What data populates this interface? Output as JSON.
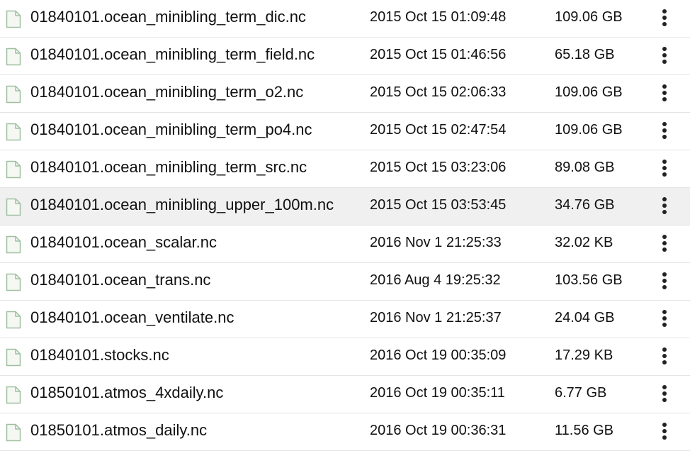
{
  "files": [
    {
      "name": "01840101.ocean_minibling_term_dic.nc",
      "date": "2015 Oct 15 01:09:48",
      "size": "109.06 GB",
      "icon": "file-icon",
      "highlighted": false
    },
    {
      "name": "01840101.ocean_minibling_term_field.nc",
      "date": "2015 Oct 15 01:46:56",
      "size": "65.18 GB",
      "icon": "file-icon",
      "highlighted": false
    },
    {
      "name": "01840101.ocean_minibling_term_o2.nc",
      "date": "2015 Oct 15 02:06:33",
      "size": "109.06 GB",
      "icon": "file-icon",
      "highlighted": false
    },
    {
      "name": "01840101.ocean_minibling_term_po4.nc",
      "date": "2015 Oct 15 02:47:54",
      "size": "109.06 GB",
      "icon": "file-icon",
      "highlighted": false
    },
    {
      "name": "01840101.ocean_minibling_term_src.nc",
      "date": "2015 Oct 15 03:23:06",
      "size": "89.08 GB",
      "icon": "file-icon",
      "highlighted": false
    },
    {
      "name": "01840101.ocean_minibling_upper_100m.nc",
      "date": "2015 Oct 15 03:53:45",
      "size": "34.76 GB",
      "icon": "file-icon",
      "highlighted": true
    },
    {
      "name": "01840101.ocean_scalar.nc",
      "date": "2016 Nov 1 21:25:33",
      "size": "32.02 KB",
      "icon": "file-icon",
      "highlighted": false
    },
    {
      "name": "01840101.ocean_trans.nc",
      "date": "2016 Aug 4 19:25:32",
      "size": "103.56 GB",
      "icon": "file-icon",
      "highlighted": false
    },
    {
      "name": "01840101.ocean_ventilate.nc",
      "date": "2016 Nov 1 21:25:37",
      "size": "24.04 GB",
      "icon": "file-icon",
      "highlighted": false
    },
    {
      "name": "01840101.stocks.nc",
      "date": "2016 Oct 19 00:35:09",
      "size": "17.29 KB",
      "icon": "file-icon",
      "highlighted": false
    },
    {
      "name": "01850101.atmos_4xdaily.nc",
      "date": "2016 Oct 19 00:35:11",
      "size": "6.77 GB",
      "icon": "file-icon",
      "highlighted": false
    },
    {
      "name": "01850101.atmos_daily.nc",
      "date": "2016 Oct 19 00:36:31",
      "size": "11.56 GB",
      "icon": "file-icon",
      "highlighted": false
    }
  ],
  "colors": {
    "highlight_row": "#f0f0f0",
    "row_divider": "#e4e4e4",
    "icon_stroke": "#9fbfa0",
    "icon_fill": "#f4f7f2",
    "text": "#111111",
    "menu_dots": "#222222"
  },
  "icons": {
    "file": "file-icon",
    "menu": "more-vert-icon"
  }
}
